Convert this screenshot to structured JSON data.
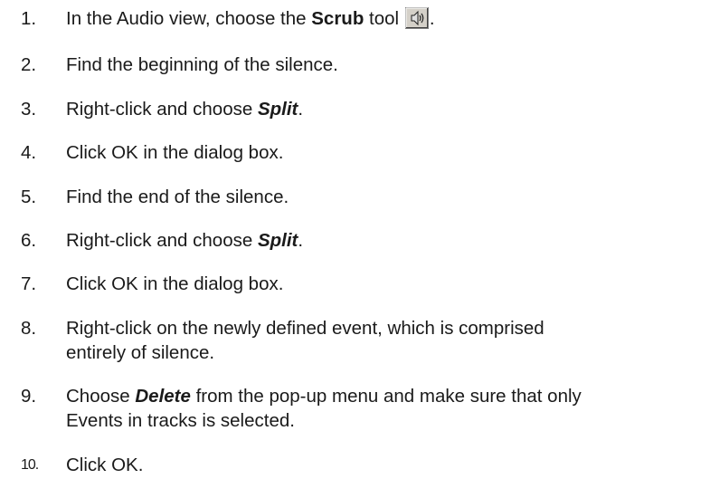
{
  "steps": [
    {
      "number": "1.",
      "parts": {
        "before": "In the Audio view, choose the ",
        "bold": "Scrub",
        "after_bold": " tool ",
        "icon": "scrub-tool-icon",
        "end": "."
      }
    },
    {
      "number": "2.",
      "text": "Find the beginning of the silence."
    },
    {
      "number": "3.",
      "parts": {
        "before": "Right-click and choose ",
        "emph": "Split",
        "end": "."
      }
    },
    {
      "number": "4.",
      "text": "Click OK in the dialog box."
    },
    {
      "number": "5.",
      "text": "Find the end of the silence."
    },
    {
      "number": "6.",
      "parts": {
        "before": "Right-click and choose ",
        "emph": "Split",
        "end": "."
      }
    },
    {
      "number": "7.",
      "text": "Click OK in the dialog box."
    },
    {
      "number": "8.",
      "line1": "Right-click on the newly defined event, which is comprised",
      "line2": "entirely of silence."
    },
    {
      "number": "9.",
      "parts": {
        "before": "Choose ",
        "emph": "Delete",
        "after": " from the pop-up menu and make sure that only"
      },
      "line2": "Events in tracks is selected."
    },
    {
      "number": "10.",
      "text": "Click OK."
    }
  ]
}
